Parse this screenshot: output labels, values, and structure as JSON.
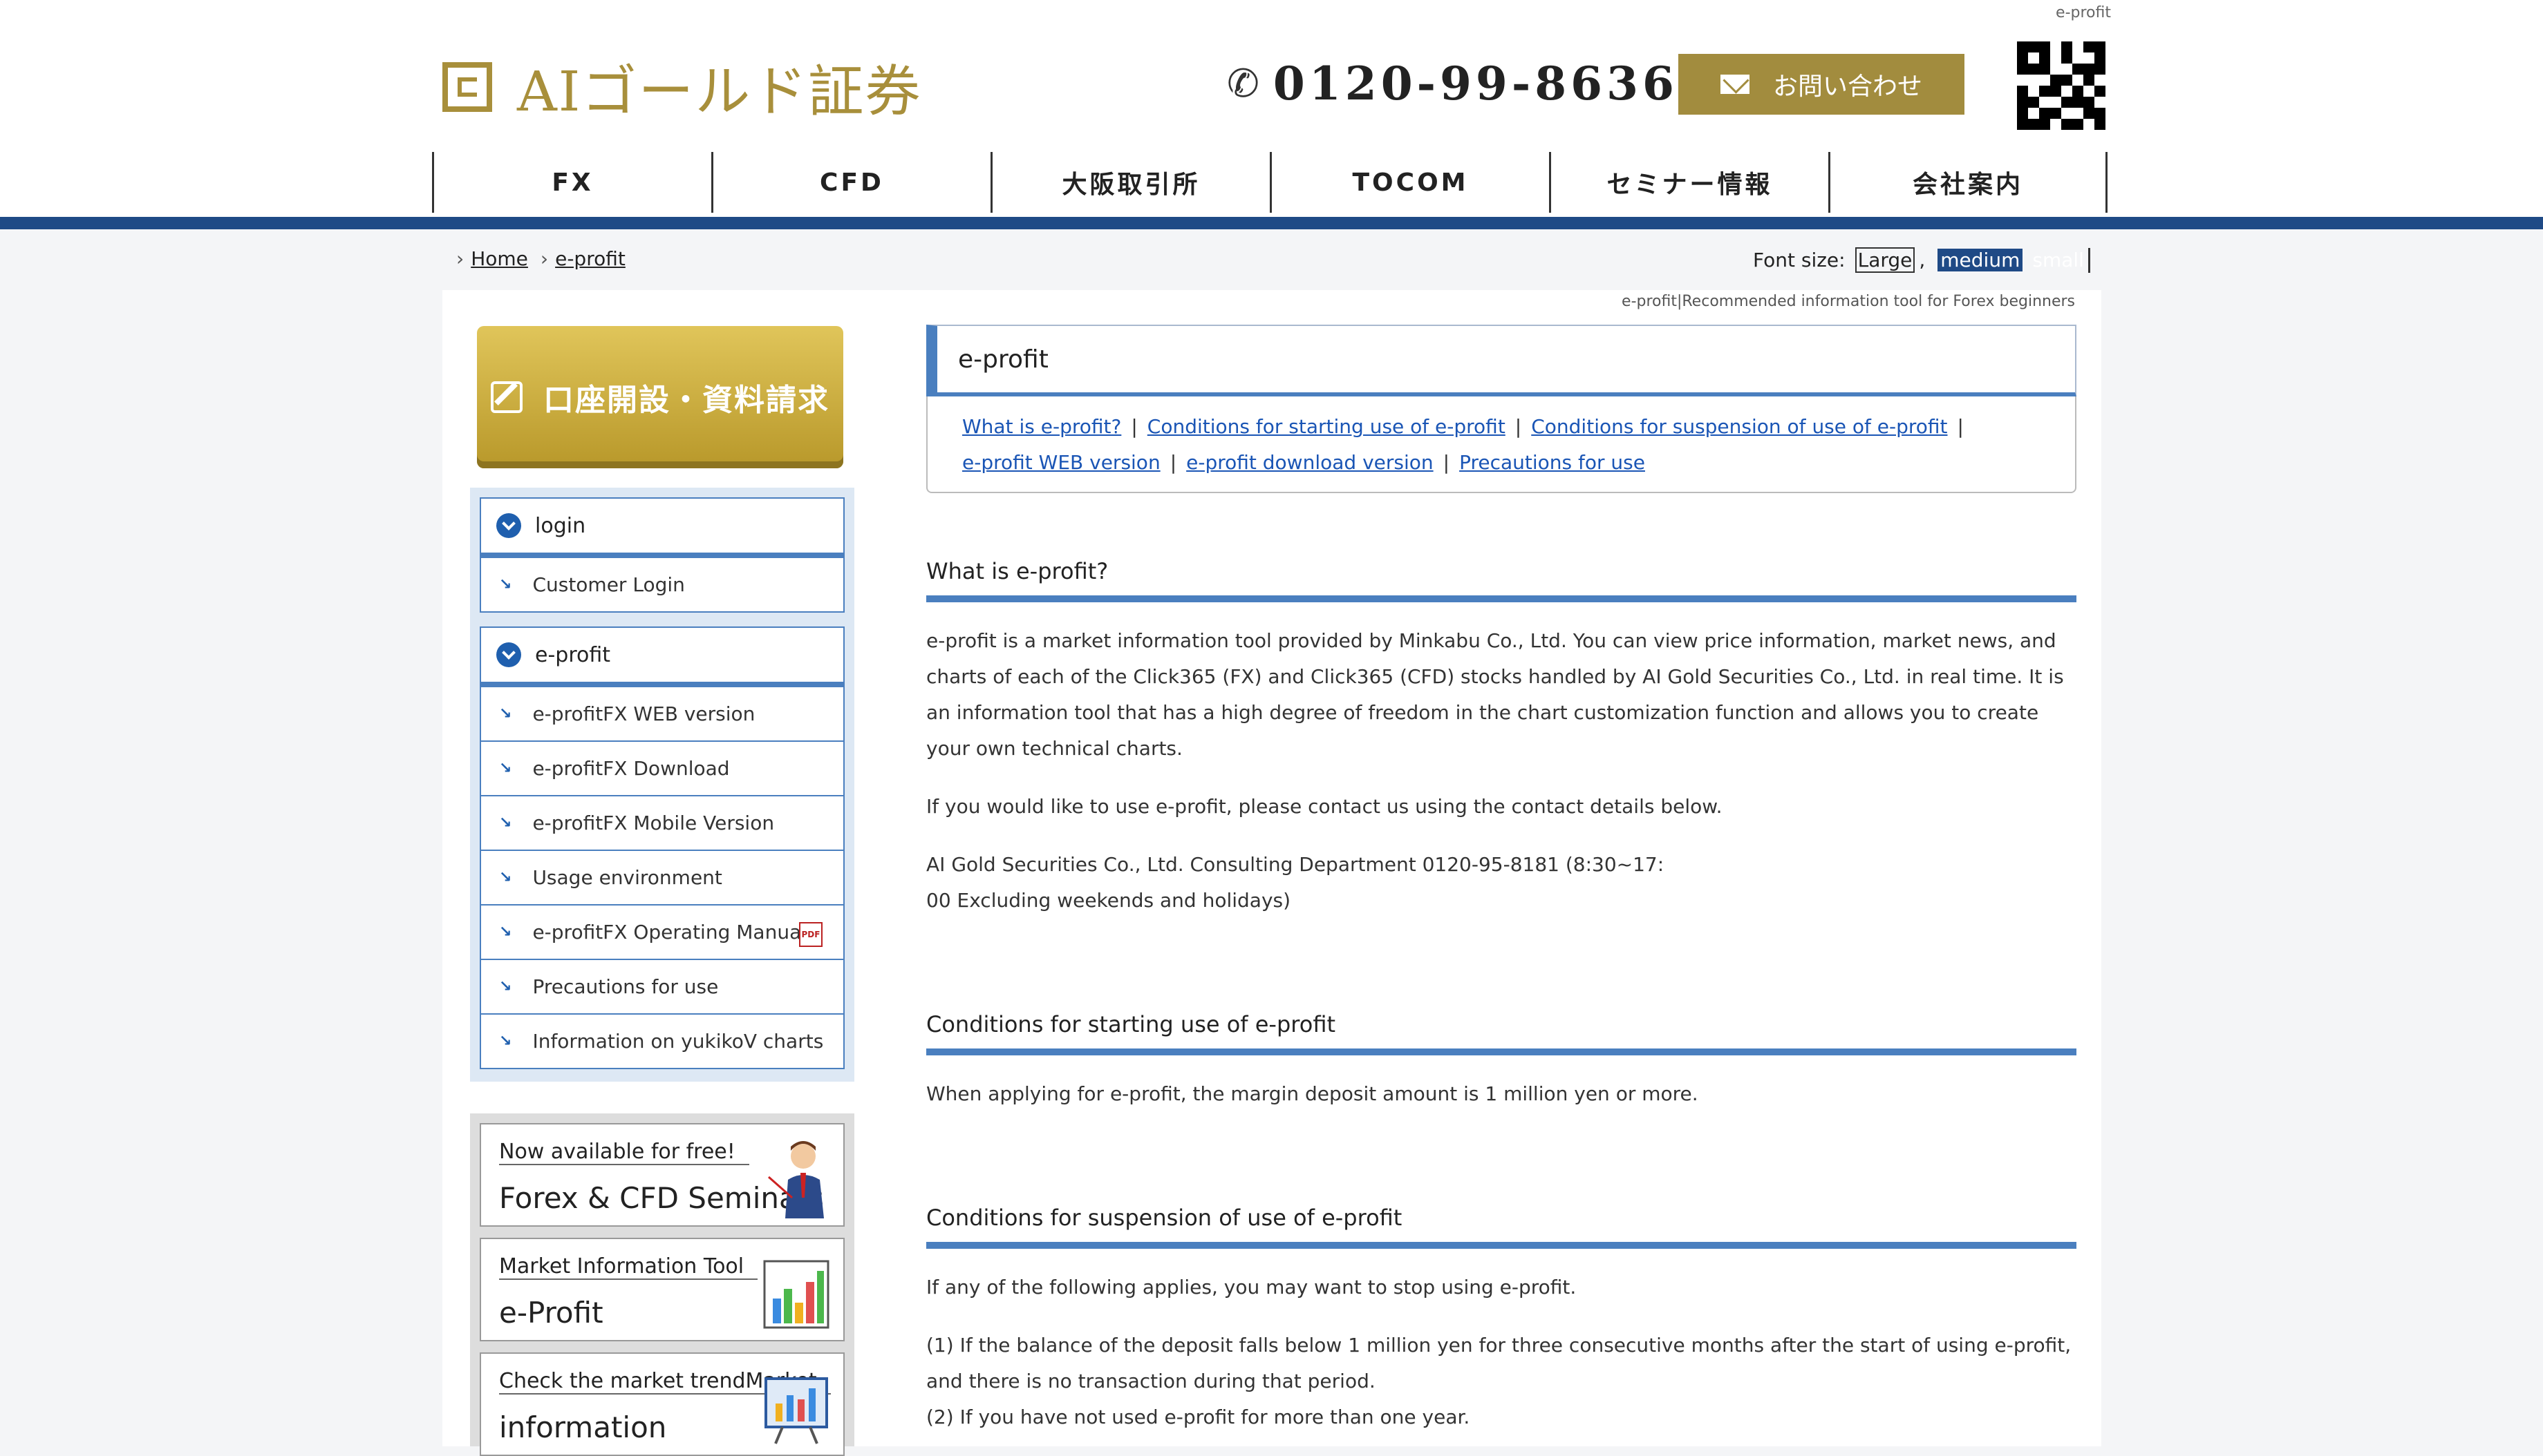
{
  "header": {
    "top_tag": "e-profit",
    "logo_text": "AIゴールド証券",
    "phone": "0120-99-8636",
    "contact_label": "お問い合わせ",
    "nav": [
      "FX",
      "CFD",
      "大阪取引所",
      "TOCOM",
      "セミナー情報",
      "会社案内"
    ]
  },
  "breadcrumb": [
    "Home",
    "e-profit"
  ],
  "fontsize": {
    "label": "Font size:",
    "large": "Large",
    "sep": ",",
    "medium": "medium",
    "small": "small"
  },
  "subtag": "e-profit|Recommended information tool for Forex beginners",
  "sidebar": {
    "cta_label": "口座開設・資料請求",
    "group1": {
      "title": "login",
      "items": [
        "Customer Login"
      ]
    },
    "group2": {
      "title": "e-profit",
      "items": [
        "e-profitFX WEB version",
        "e-profitFX Download",
        "e-profitFX Mobile Version",
        "Usage environment",
        "e-profitFX Operating Manual",
        "Precautions for use",
        "Information on yukikoV charts"
      ]
    },
    "banners": [
      {
        "small": "Now available for free!",
        "big": "Forex & CFD Seminars"
      },
      {
        "small": "Market Information Tool",
        "big": "e-Profit"
      },
      {
        "small": "Check the market trendMarket",
        "big": "information"
      }
    ]
  },
  "content": {
    "title": "e-profit",
    "toc": [
      "What is e-profit?",
      "Conditions for starting use of e-profit",
      "Conditions for suspension of use of e-profit",
      "e-profit WEB version",
      "e-profit download version",
      "Precautions for use"
    ],
    "s1_title": "What is e-profit?",
    "s1_p1": "e-profit is a market information tool provided by Minkabu Co., Ltd. You can view price information, market news, and charts of each of the Click365 (FX) and Click365 (CFD) stocks handled by AI Gold Securities Co., Ltd. in real time. It is an information tool that has a high degree of freedom in the chart customization function and allows you to create your own technical charts.",
    "s1_p2": "If you would like to use e-profit, please contact us using the contact details below.",
    "s1_p3a": "AI Gold Securities Co., Ltd. Consulting Department 0120-95-8181 (8:30~17:",
    "s1_p3b": "00 Excluding weekends and holidays)",
    "s2_title": "Conditions for starting use of e-profit",
    "s2_p1": "When applying for e-profit, the margin deposit amount is 1 million yen or more.",
    "s3_title": "Conditions for suspension of use of e-profit",
    "s3_p1": "If any of the following applies, you may want to stop using e-profit.",
    "s3_p2": "(1) If the balance of the deposit falls below 1 million yen for three consecutive months after the start of using e-profit, and there is no transaction during that period.",
    "s3_p3": "(2) If you have not used e-profit for more than one year."
  }
}
